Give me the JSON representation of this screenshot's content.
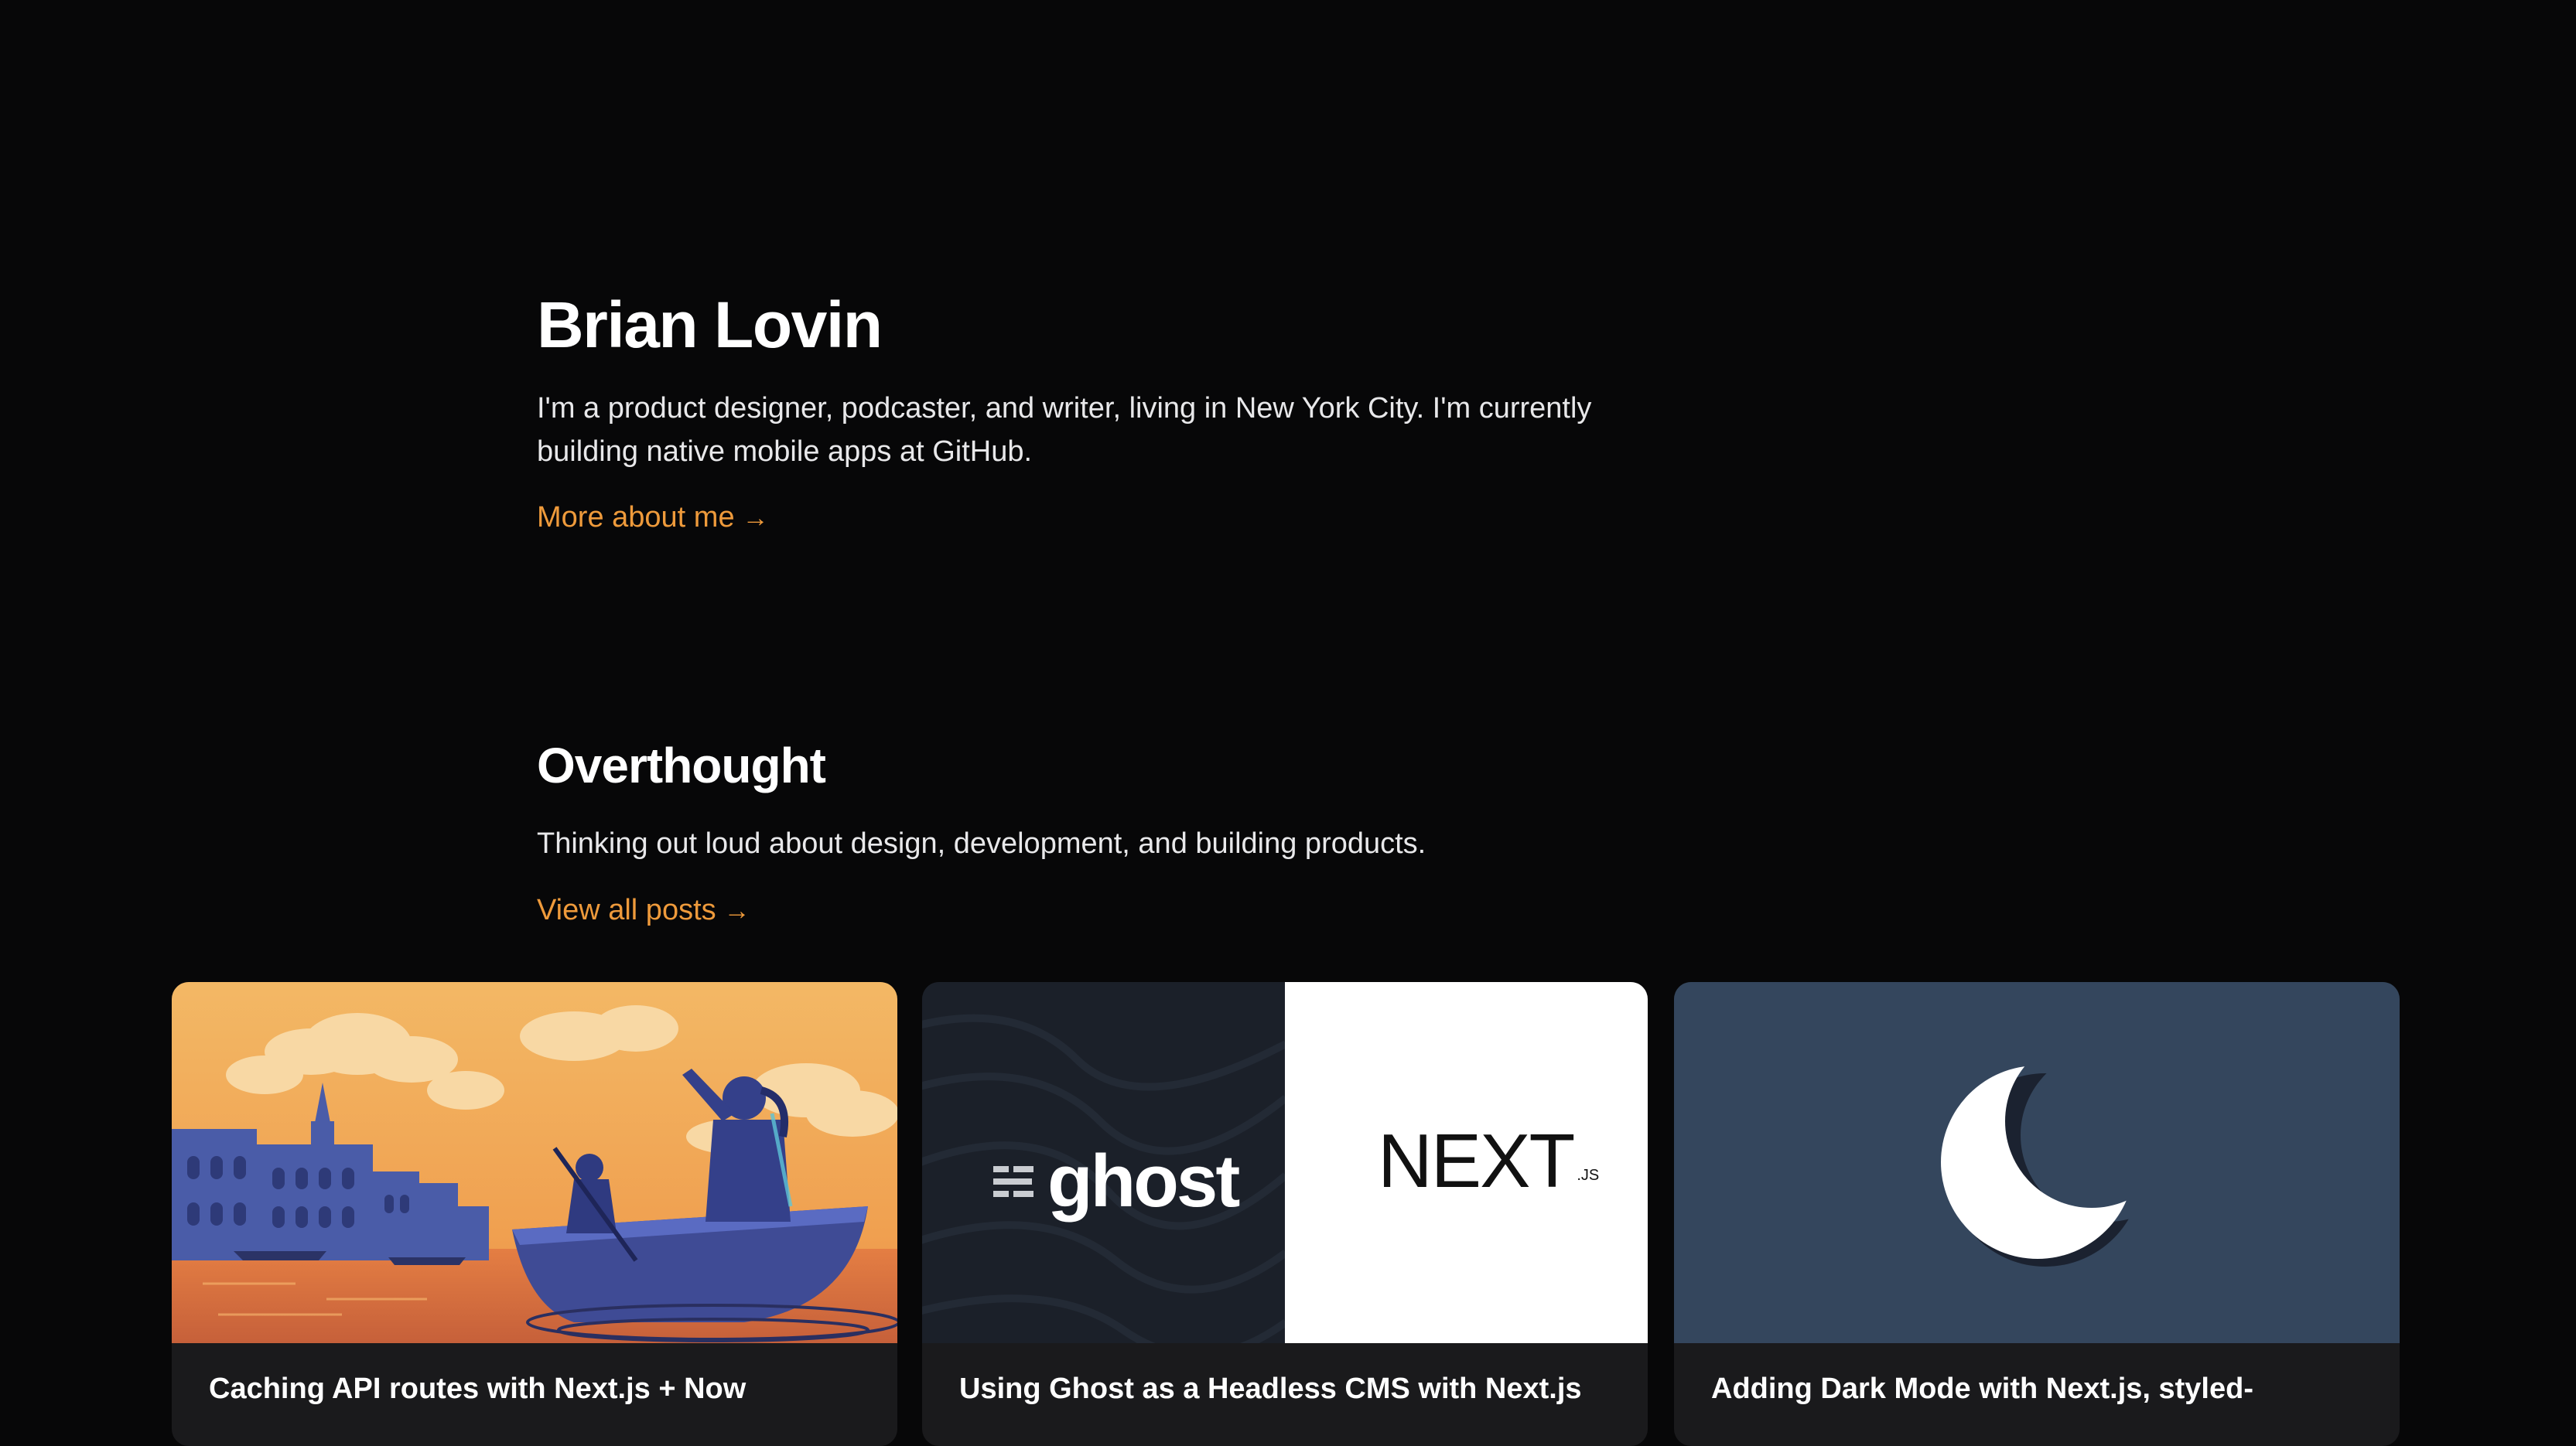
{
  "intro": {
    "name": "Brian Lovin",
    "bio": "I'm a product designer, podcaster, and writer, living in New York City. I'm currently building native mobile apps at GitHub.",
    "more_link": "More about me",
    "arrow": "→"
  },
  "blog": {
    "title": "Overthought",
    "description": "Thinking out loud about design, development, and building products.",
    "view_all": "View all posts",
    "arrow": "→",
    "posts": [
      {
        "title": "Caching API routes with Next.js + Now",
        "image": "venice-boat-illustration"
      },
      {
        "title": "Using Ghost as a Headless CMS with Next.js",
        "image": "ghost-nextjs-logos",
        "logo_left": "ghost",
        "logo_right": "NEXT",
        "logo_right_suffix": ".JS"
      },
      {
        "title": "Adding Dark Mode with Next.js, styled-",
        "image": "crescent-moon"
      }
    ]
  },
  "colors": {
    "background": "#070708",
    "accent": "#ee9a3b",
    "card": "#1a1a1c",
    "moon_card": "#34465d"
  }
}
